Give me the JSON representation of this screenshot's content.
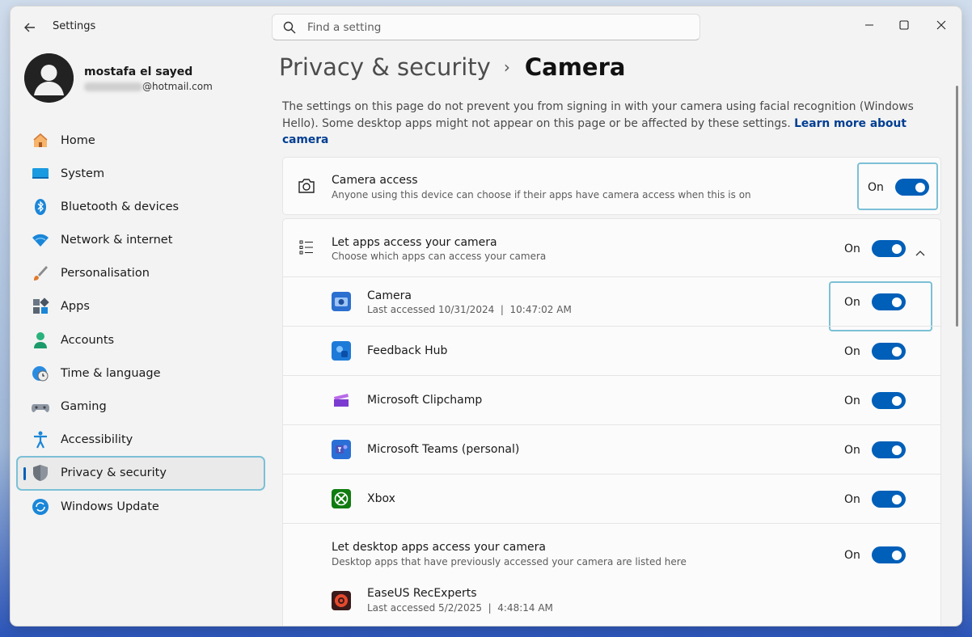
{
  "window": {
    "app_title": "Settings"
  },
  "search": {
    "placeholder": "Find a setting"
  },
  "profile": {
    "name": "mostafa el sayed",
    "email_domain": "@hotmail.com"
  },
  "sidebar": {
    "items": [
      {
        "label": "Home",
        "icon": "home-icon"
      },
      {
        "label": "System",
        "icon": "system-icon"
      },
      {
        "label": "Bluetooth & devices",
        "icon": "bluetooth-icon"
      },
      {
        "label": "Network & internet",
        "icon": "wifi-icon"
      },
      {
        "label": "Personalisation",
        "icon": "brush-icon"
      },
      {
        "label": "Apps",
        "icon": "apps-icon"
      },
      {
        "label": "Accounts",
        "icon": "accounts-icon"
      },
      {
        "label": "Time & language",
        "icon": "globe-clock-icon"
      },
      {
        "label": "Gaming",
        "icon": "gamepad-icon"
      },
      {
        "label": "Accessibility",
        "icon": "accessibility-icon"
      },
      {
        "label": "Privacy & security",
        "icon": "shield-icon",
        "selected": true
      },
      {
        "label": "Windows Update",
        "icon": "update-icon"
      }
    ]
  },
  "breadcrumb": {
    "parent": "Privacy & security",
    "separator": "›",
    "current": "Camera"
  },
  "description": {
    "text": "The settings on this page do not prevent you from signing in with your camera using facial recognition (Windows Hello). Some desktop apps might not appear on this page or be affected by these settings.",
    "link": "Learn more about camera"
  },
  "camera_access": {
    "title": "Camera access",
    "subtitle": "Anyone using this device can choose if their apps have camera access when this is on",
    "state": "On"
  },
  "let_apps": {
    "title": "Let apps access your camera",
    "subtitle": "Choose which apps can access your camera",
    "state": "On"
  },
  "apps": [
    {
      "name": "Camera",
      "detail": "Last accessed 10/31/2024  |  10:47:02 AM",
      "state": "On",
      "icon": "camera-app-icon"
    },
    {
      "name": "Feedback Hub",
      "detail": "",
      "state": "On",
      "icon": "feedback-hub-icon"
    },
    {
      "name": "Microsoft Clipchamp",
      "detail": "",
      "state": "On",
      "icon": "clipchamp-icon"
    },
    {
      "name": "Microsoft Teams (personal)",
      "detail": "",
      "state": "On",
      "icon": "teams-icon"
    },
    {
      "name": "Xbox",
      "detail": "",
      "state": "On",
      "icon": "xbox-icon"
    }
  ],
  "desktop_apps": {
    "title": "Let desktop apps access your camera",
    "subtitle": "Desktop apps that have previously accessed your camera are listed here",
    "state": "On",
    "items": [
      {
        "name": "EaseUS RecExperts",
        "detail": "Last accessed 5/2/2025  |  4:48:14 AM",
        "icon": "easeus-icon"
      }
    ]
  },
  "colors": {
    "accent": "#005fb8",
    "highlight": "#7cc0d6"
  }
}
